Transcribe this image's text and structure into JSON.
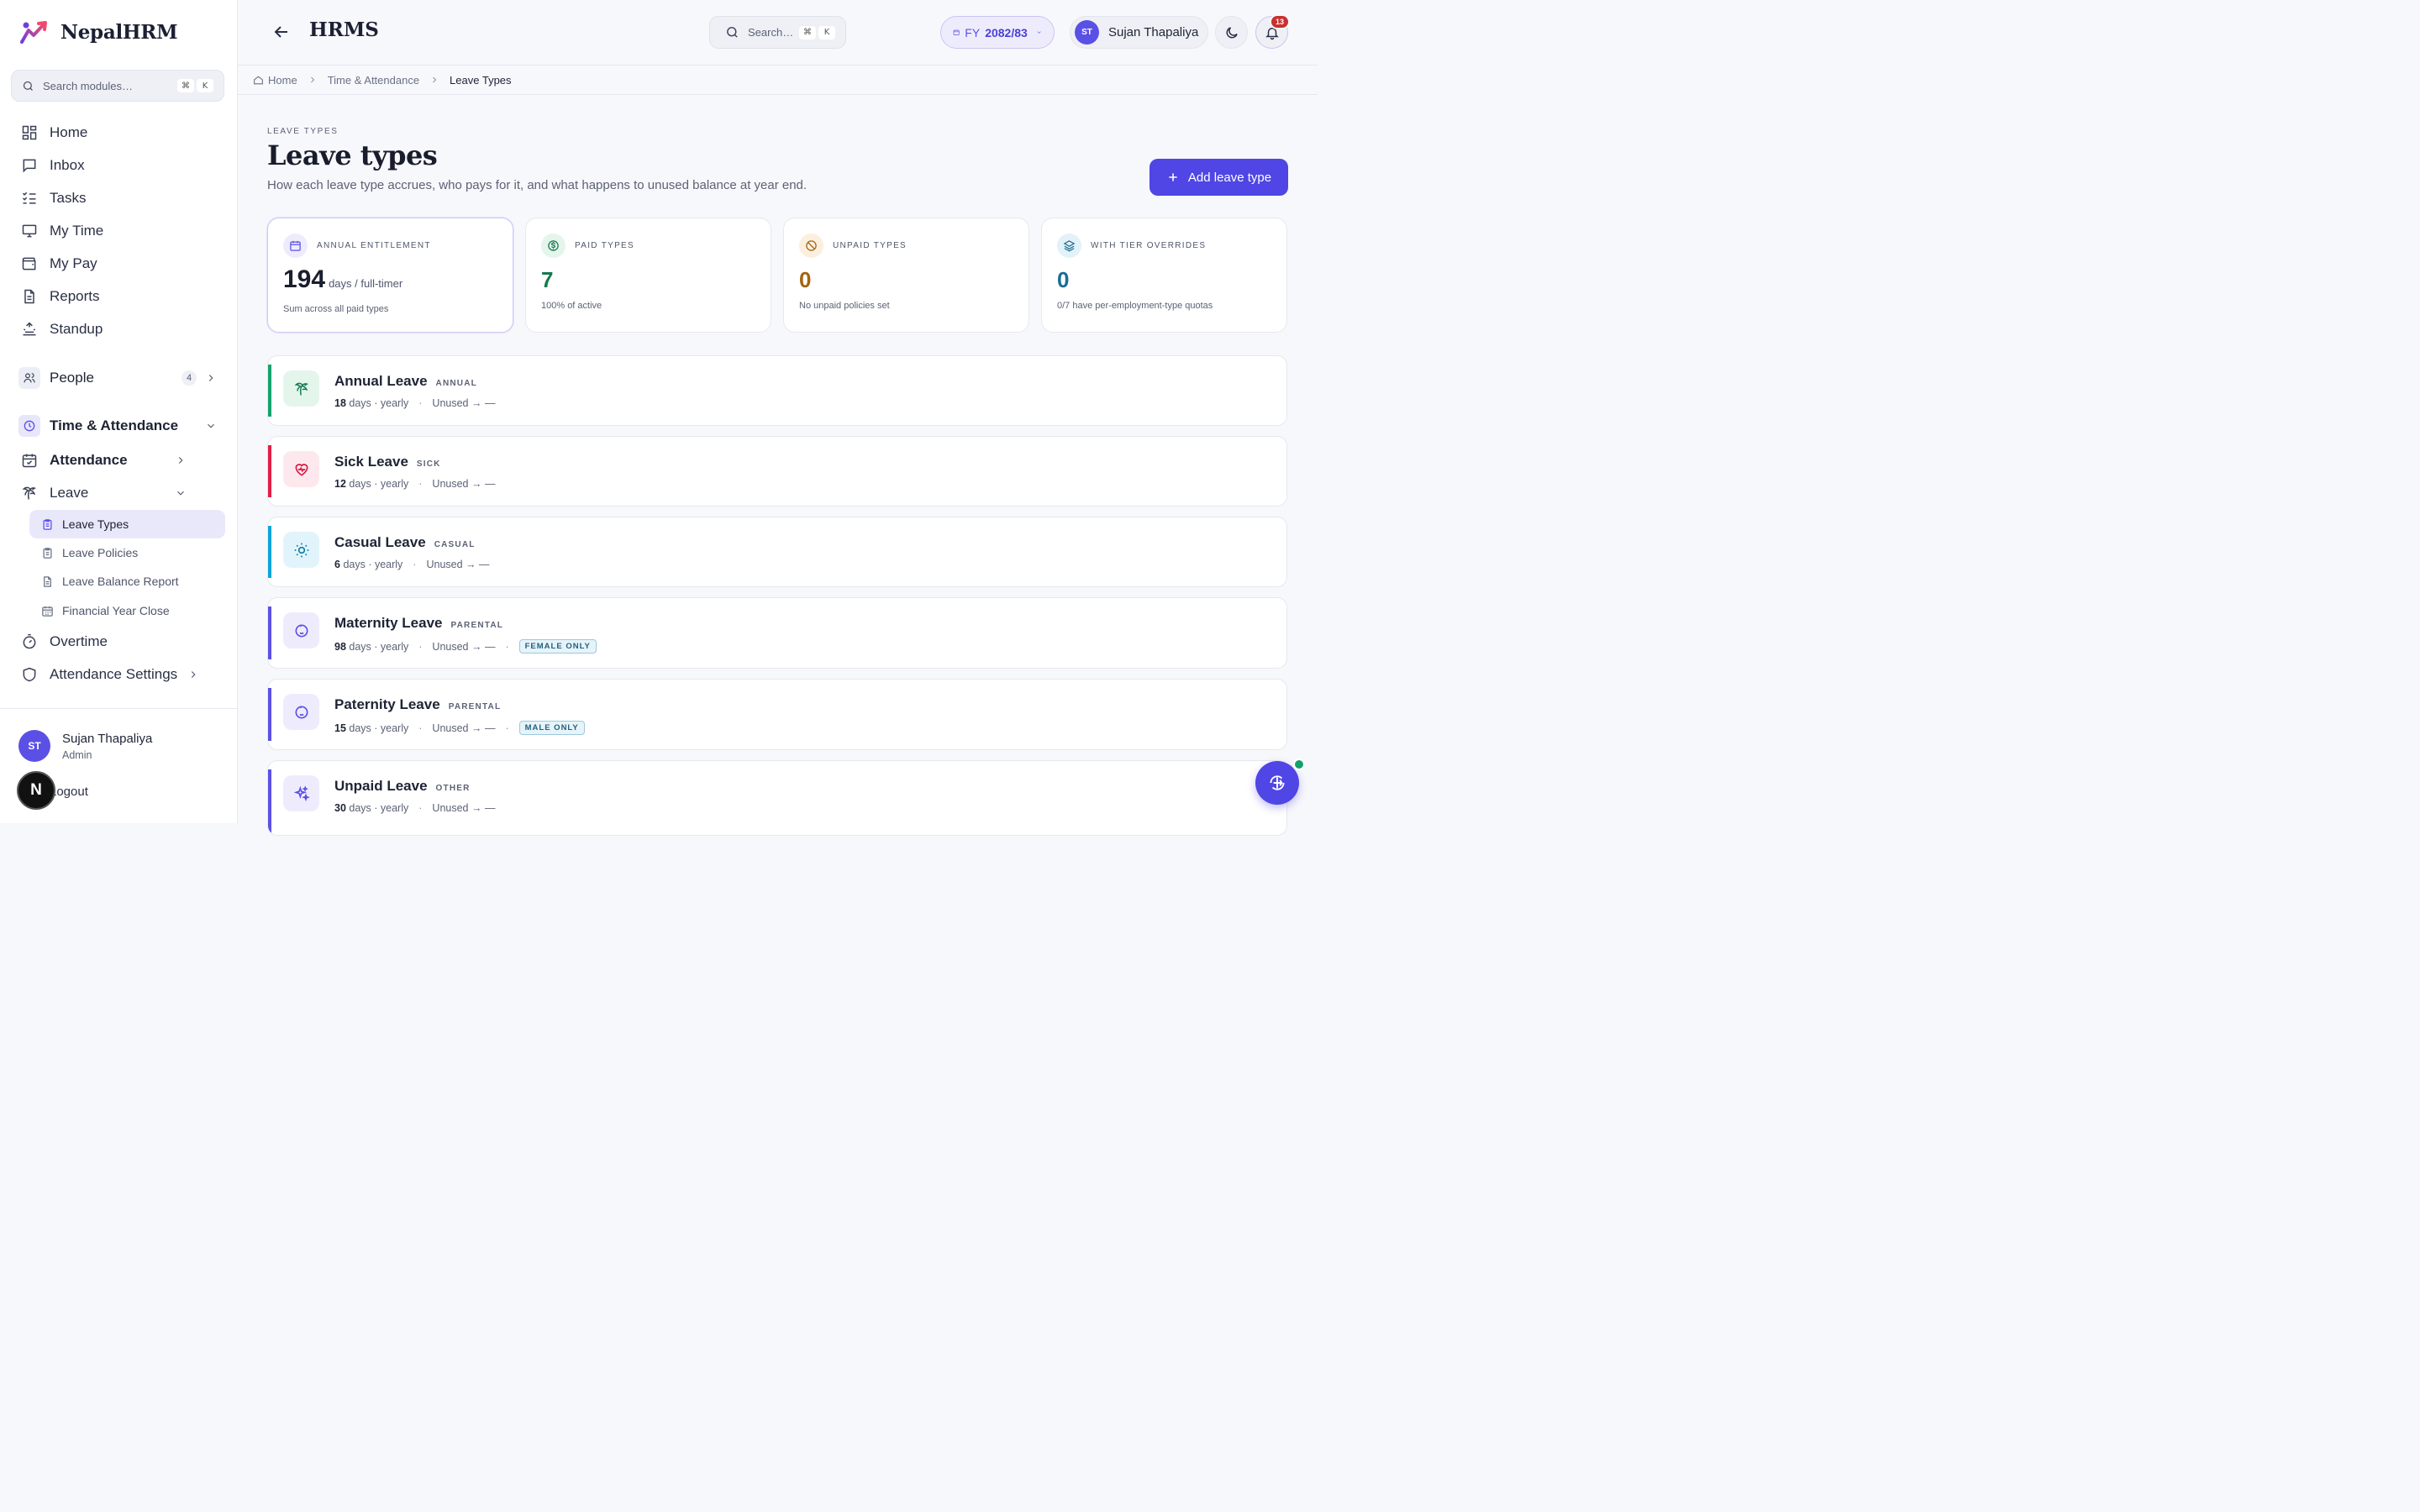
{
  "brand": {
    "name": "NepalHRM"
  },
  "sidebar": {
    "search_placeholder": "Search modules…",
    "kbd1": "⌘",
    "kbd2": "K",
    "items": [
      {
        "label": "Home"
      },
      {
        "label": "Inbox"
      },
      {
        "label": "Tasks"
      },
      {
        "label": "My Time"
      },
      {
        "label": "My Pay"
      },
      {
        "label": "Reports"
      },
      {
        "label": "Standup"
      }
    ],
    "people": {
      "label": "People",
      "count": "4"
    },
    "time_attendance": {
      "label": "Time & Attendance"
    },
    "attendance": {
      "label": "Attendance"
    },
    "leave": {
      "label": "Leave"
    },
    "leave_sub": [
      {
        "label": "Leave Types"
      },
      {
        "label": "Leave Policies"
      },
      {
        "label": "Leave Balance Report"
      },
      {
        "label": "Financial Year Close"
      }
    ],
    "overtime": {
      "label": "Overtime"
    },
    "attendance_settings": {
      "label": "Attendance Settings"
    },
    "user": {
      "initials": "ST",
      "name": "Sujan Thapaliya",
      "role": "Admin",
      "logout": "Logout"
    }
  },
  "topbar": {
    "title": "HRMS",
    "search_placeholder": "Search…",
    "kbd1": "⌘",
    "kbd2": "K",
    "fy_prefix": "FY",
    "fy_value": "2082/83",
    "user_initials": "ST",
    "user_name": "Sujan Thapaliya",
    "notif_count": "13"
  },
  "breadcrumb": {
    "home": "Home",
    "parent": "Time & Attendance",
    "current": "Leave Types"
  },
  "page": {
    "eyebrow": "LEAVE TYPES",
    "title": "Leave types",
    "description": "How each leave type accrues, who pays for it, and what happens to unused balance at year end.",
    "add_button": "Add leave type"
  },
  "stats": [
    {
      "label": "ANNUAL ENTITLEMENT",
      "value": "194",
      "unit": "days / full-timer",
      "sub": "Sum across all paid types",
      "color": "#1a1f2e"
    },
    {
      "label": "PAID TYPES",
      "value": "7",
      "unit": "",
      "sub": "100% of active",
      "color": "#157a4f"
    },
    {
      "label": "UNPAID TYPES",
      "value": "0",
      "unit": "",
      "sub": "No unpaid policies set",
      "color": "#a36410"
    },
    {
      "label": "WITH TIER OVERRIDES",
      "value": "0",
      "unit": "",
      "sub": "0/7 have per-employment-type quotas",
      "color": "#1a6d94"
    }
  ],
  "leave_types": [
    {
      "name": "Annual Leave",
      "tag": "ANNUAL",
      "days": "18",
      "freq": "days · yearly",
      "unused": "Unused → —",
      "pill": "",
      "accent": "#16a36a"
    },
    {
      "name": "Sick Leave",
      "tag": "SICK",
      "days": "12",
      "freq": "days · yearly",
      "unused": "Unused → —",
      "pill": "",
      "accent": "#e11d48"
    },
    {
      "name": "Casual Leave",
      "tag": "CASUAL",
      "days": "6",
      "freq": "days · yearly",
      "unused": "Unused → —",
      "pill": "",
      "accent": "#0ea5d9"
    },
    {
      "name": "Maternity Leave",
      "tag": "PARENTAL",
      "days": "98",
      "freq": "days · yearly",
      "unused": "Unused → —",
      "pill": "FEMALE ONLY",
      "accent": "#5b50e6"
    },
    {
      "name": "Paternity Leave",
      "tag": "PARENTAL",
      "days": "15",
      "freq": "days · yearly",
      "unused": "Unused → —",
      "pill": "MALE ONLY",
      "accent": "#5b50e6"
    },
    {
      "name": "Unpaid Leave",
      "tag": "OTHER",
      "days": "30",
      "freq": "days · yearly",
      "unused": "Unused → —",
      "pill": "",
      "accent": "#5b50e6"
    }
  ],
  "misc": {
    "n_badge": "N"
  }
}
